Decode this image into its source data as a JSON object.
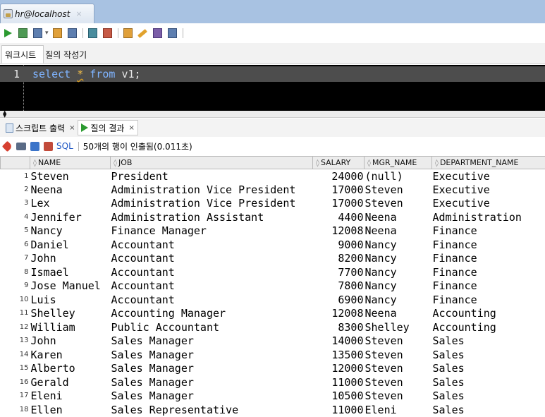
{
  "connection_tab": {
    "label": "hr@localhost",
    "close": "×"
  },
  "toolbar": {
    "icons": [
      "run-statement-icon",
      "run-script-icon",
      "commit-icon",
      "rollback-icon",
      "autotrace-icon",
      "explain-plan-icon",
      "sql-tuning-icon",
      "clear-icon",
      "history-icon",
      "format-icon"
    ]
  },
  "editor_tabs": [
    "워크시트",
    "질의 작성기"
  ],
  "editor": {
    "line_number": "1",
    "keyword1": "select",
    "star": "*",
    "keyword2": "from",
    "rest": "v1;"
  },
  "result_tabs": [
    {
      "label": "스크립트 출력",
      "close": "×"
    },
    {
      "label": "질의 결과",
      "close": "×"
    }
  ],
  "result_toolbar": {
    "sql_label": "SQL",
    "status": "50개의 행이 인출됨(0.011초)"
  },
  "grid": {
    "columns": [
      "NAME",
      "JOB",
      "SALARY",
      "MGR_NAME",
      "DEPARTMENT_NAME"
    ],
    "rows": [
      [
        "1",
        "Steven",
        "President",
        "24000",
        "(null)",
        "Executive"
      ],
      [
        "2",
        "Neena",
        "Administration Vice President",
        "17000",
        "Steven",
        "Executive"
      ],
      [
        "3",
        "Lex",
        "Administration Vice President",
        "17000",
        "Steven",
        "Executive"
      ],
      [
        "4",
        "Jennifer",
        "Administration Assistant",
        "4400",
        "Neena",
        "Administration"
      ],
      [
        "5",
        "Nancy",
        "Finance Manager",
        "12008",
        "Neena",
        "Finance"
      ],
      [
        "6",
        "Daniel",
        "Accountant",
        "9000",
        "Nancy",
        "Finance"
      ],
      [
        "7",
        "John",
        "Accountant",
        "8200",
        "Nancy",
        "Finance"
      ],
      [
        "8",
        "Ismael",
        "Accountant",
        "7700",
        "Nancy",
        "Finance"
      ],
      [
        "9",
        "Jose Manuel",
        "Accountant",
        "7800",
        "Nancy",
        "Finance"
      ],
      [
        "10",
        "Luis",
        "Accountant",
        "6900",
        "Nancy",
        "Finance"
      ],
      [
        "11",
        "Shelley",
        "Accounting Manager",
        "12008",
        "Neena",
        "Accounting"
      ],
      [
        "12",
        "William",
        "Public Accountant",
        "8300",
        "Shelley",
        "Accounting"
      ],
      [
        "13",
        "John",
        "Sales Manager",
        "14000",
        "Steven",
        "Sales"
      ],
      [
        "14",
        "Karen",
        "Sales Manager",
        "13500",
        "Steven",
        "Sales"
      ],
      [
        "15",
        "Alberto",
        "Sales Manager",
        "12000",
        "Steven",
        "Sales"
      ],
      [
        "16",
        "Gerald",
        "Sales Manager",
        "11000",
        "Steven",
        "Sales"
      ],
      [
        "17",
        "Eleni",
        "Sales Manager",
        "10500",
        "Steven",
        "Sales"
      ],
      [
        "18",
        "Ellen",
        "Sales Representative",
        "11000",
        "Eleni",
        "Sales"
      ]
    ]
  },
  "colors": {
    "tabstrip_bg": "#a8c2e2",
    "editor_bg": "#000000",
    "editor_current_line": "#4d4d4d",
    "keyword": "#7fb4ff",
    "run_green": "#2b9a30"
  }
}
